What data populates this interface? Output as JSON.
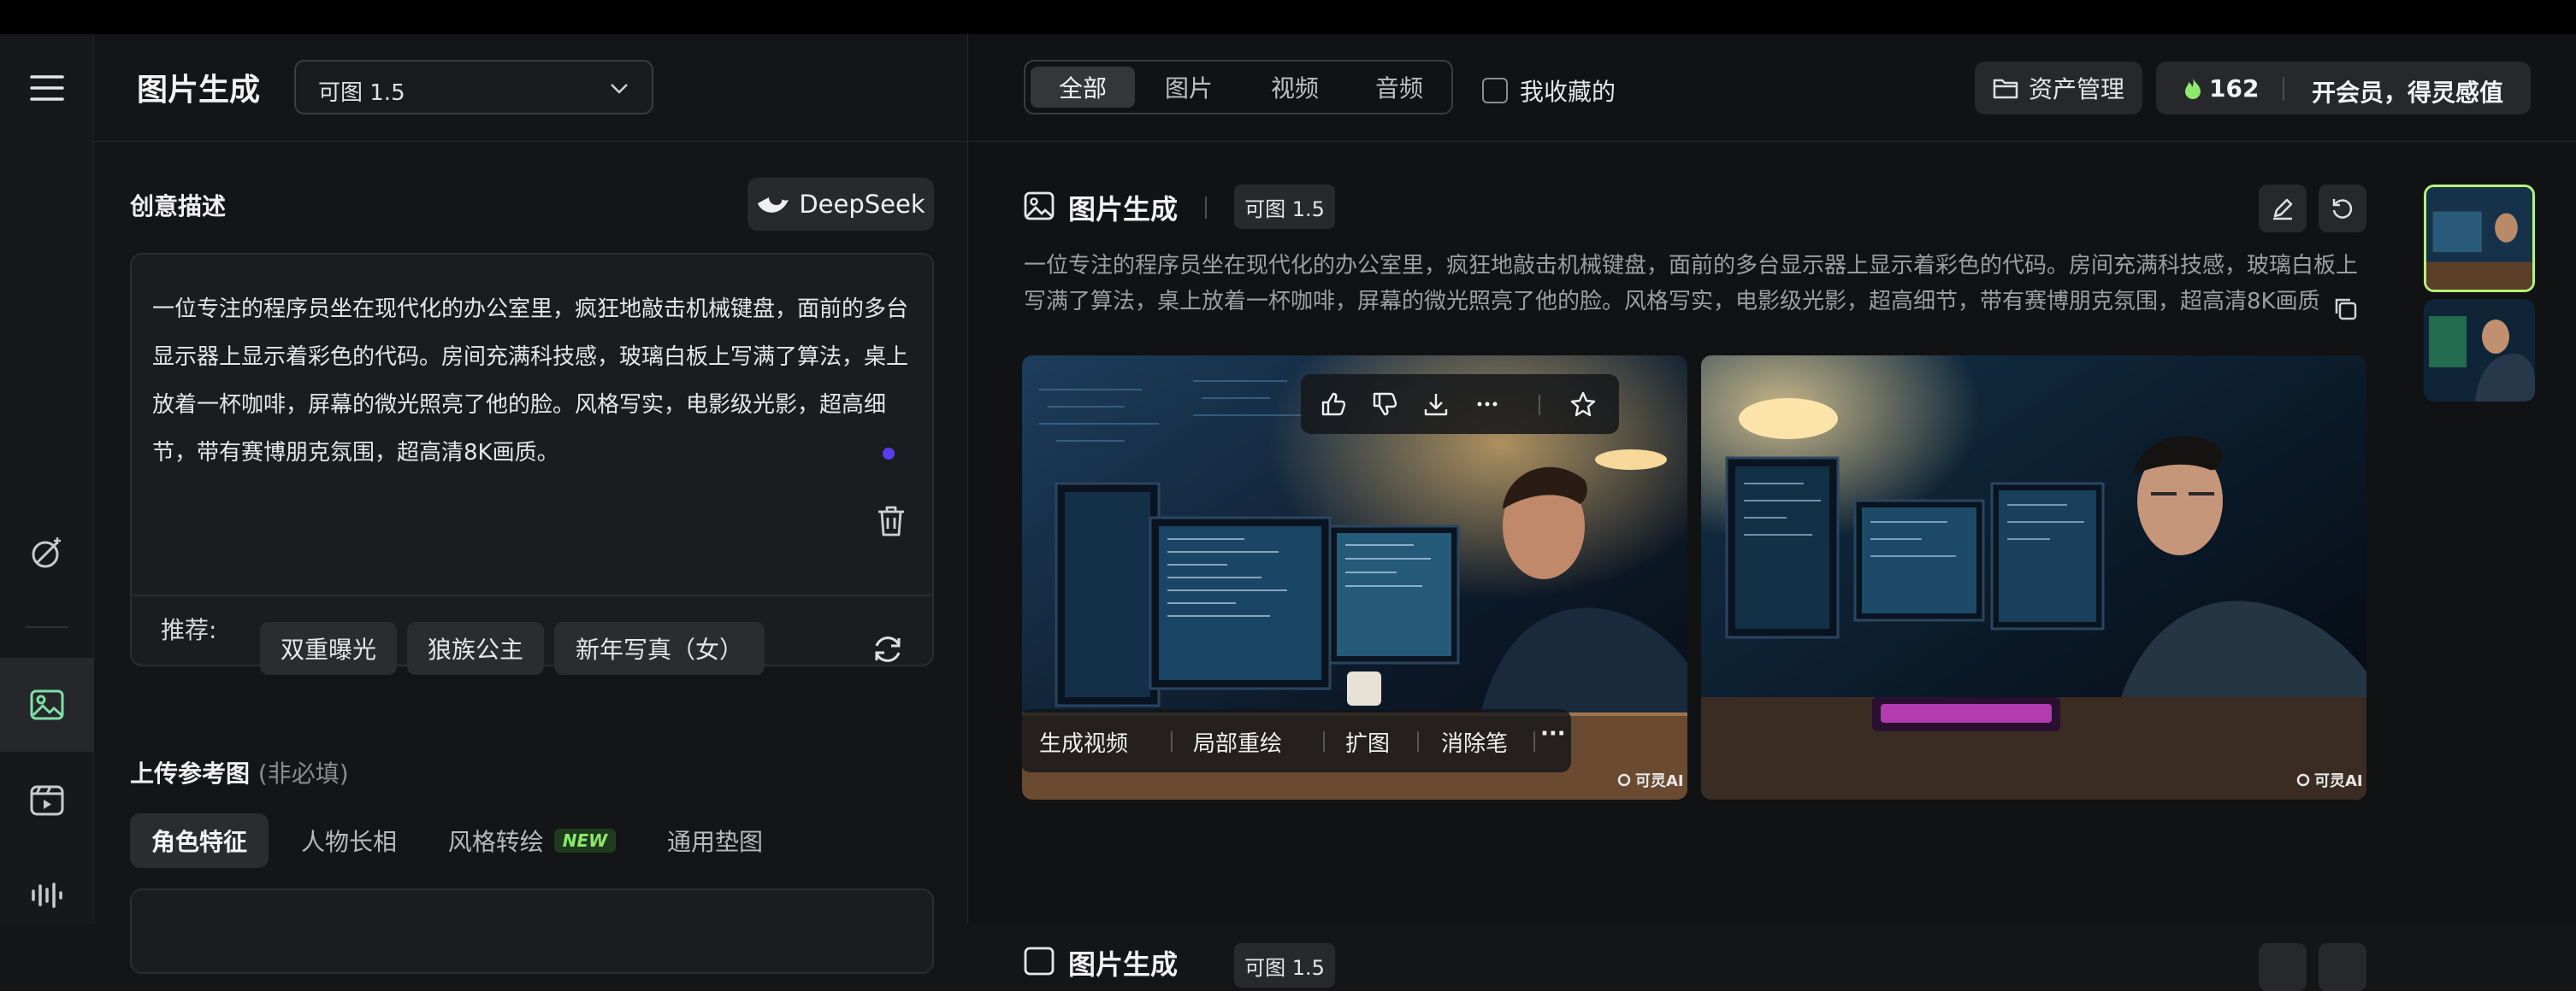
{
  "left_panel": {
    "app_title": "图片生成",
    "model_select": {
      "value": "可图 1.5"
    },
    "creative_section": {
      "title": "创意描述",
      "deepseek_label": "DeepSeek",
      "prompt_lines": [
        "一位专注的程序员坐在现代化的办公室里，疯狂地敲击机械键盘，面前的多台",
        "显示器上显示着彩色的代码。房间充满科技感，玻璃白板上写满了算法，桌上",
        "放着一杯咖啡，屏幕的微光照亮了他的脸。风格写实，电影级光影，超高细",
        "节，带有赛博朋克氛围，超高清8K画质。"
      ],
      "recommend_label": "推荐:",
      "recommend_chips": [
        "双重曝光",
        "狼族公主",
        "新年写真（女）"
      ]
    },
    "upload_section": {
      "title": "上传参考图",
      "hint": "(非必填)",
      "tabs": [
        {
          "label": "角色特征",
          "active": true
        },
        {
          "label": "人物长相",
          "active": false
        },
        {
          "label": "风格转绘",
          "active": false,
          "badge": "NEW"
        },
        {
          "label": "通用垫图",
          "active": false
        }
      ]
    }
  },
  "right_panel": {
    "filter_tabs": [
      {
        "label": "全部",
        "active": true
      },
      {
        "label": "图片",
        "active": false
      },
      {
        "label": "视频",
        "active": false
      },
      {
        "label": "音频",
        "active": false
      }
    ],
    "favorites_label": "我收藏的",
    "asset_button": "资产管理",
    "credits": {
      "count": "162",
      "vip_label": "开会员，得灵感值"
    },
    "generation_card": {
      "title": "图片生成",
      "model_badge": "可图 1.5",
      "description_line1": "一位专注的程序员坐在现代化的办公室里，疯狂地敲击机械键盘，面前的多台显示器上显示着彩色的代码。房间充满科技感，玻璃白板上",
      "description_line2": "写满了算法，桌上放着一杯咖啡，屏幕的微光照亮了他的脸。风格写实，电影级光影，超高细节，带有赛博朋克氛围，超高清8K画质",
      "image_actions": [
        "生成视频",
        "局部重绘",
        "扩图",
        "消除笔"
      ],
      "more_label": "···",
      "watermark": "可灵AI"
    },
    "next_card": {
      "title": "图片生成",
      "model_badge": "可图 1.5"
    }
  },
  "colors": {
    "accent_green": "#b6f27a",
    "badge_new": "#8ee86b",
    "dot_purple": "#5a3cf0",
    "background": "#141516"
  },
  "icons": {
    "rail": [
      "menu-icon",
      "magic-wand-icon",
      "image-icon",
      "video-icon",
      "audio-icon"
    ],
    "card": [
      "edit-icon",
      "regenerate-icon",
      "copy-icon"
    ],
    "image_hover": [
      "thumbs-up-icon",
      "thumbs-down-icon",
      "download-icon",
      "more-icon",
      "star-icon"
    ]
  }
}
